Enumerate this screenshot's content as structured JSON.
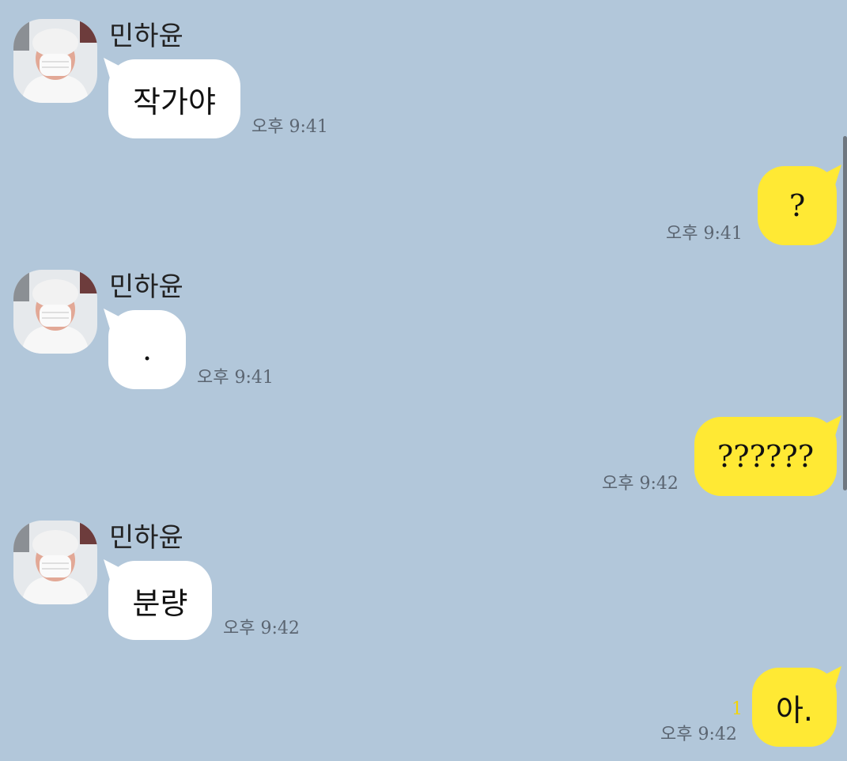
{
  "theme": {
    "background": "#b2c7da",
    "incoming_bubble": "#ffffff",
    "outgoing_bubble": "#ffe934",
    "time_color": "#5b6571",
    "unread_color": "#f4d400"
  },
  "messages": [
    {
      "direction": "incoming",
      "sender": "민하윤",
      "avatar_icon": "profile-photo-icon",
      "text": "작가야",
      "time": "오후 9:41"
    },
    {
      "direction": "outgoing",
      "text": "?",
      "time": "오후 9:41"
    },
    {
      "direction": "incoming",
      "sender": "민하윤",
      "avatar_icon": "profile-photo-icon",
      "text": ".",
      "time": "오후 9:41"
    },
    {
      "direction": "outgoing",
      "text": "??????",
      "time": "오후 9:42"
    },
    {
      "direction": "incoming",
      "sender": "민하윤",
      "avatar_icon": "profile-photo-icon",
      "text": "분량",
      "time": "오후 9:42"
    },
    {
      "direction": "outgoing",
      "text": "아.",
      "time": "오후 9:42",
      "unread_count": "1"
    }
  ]
}
